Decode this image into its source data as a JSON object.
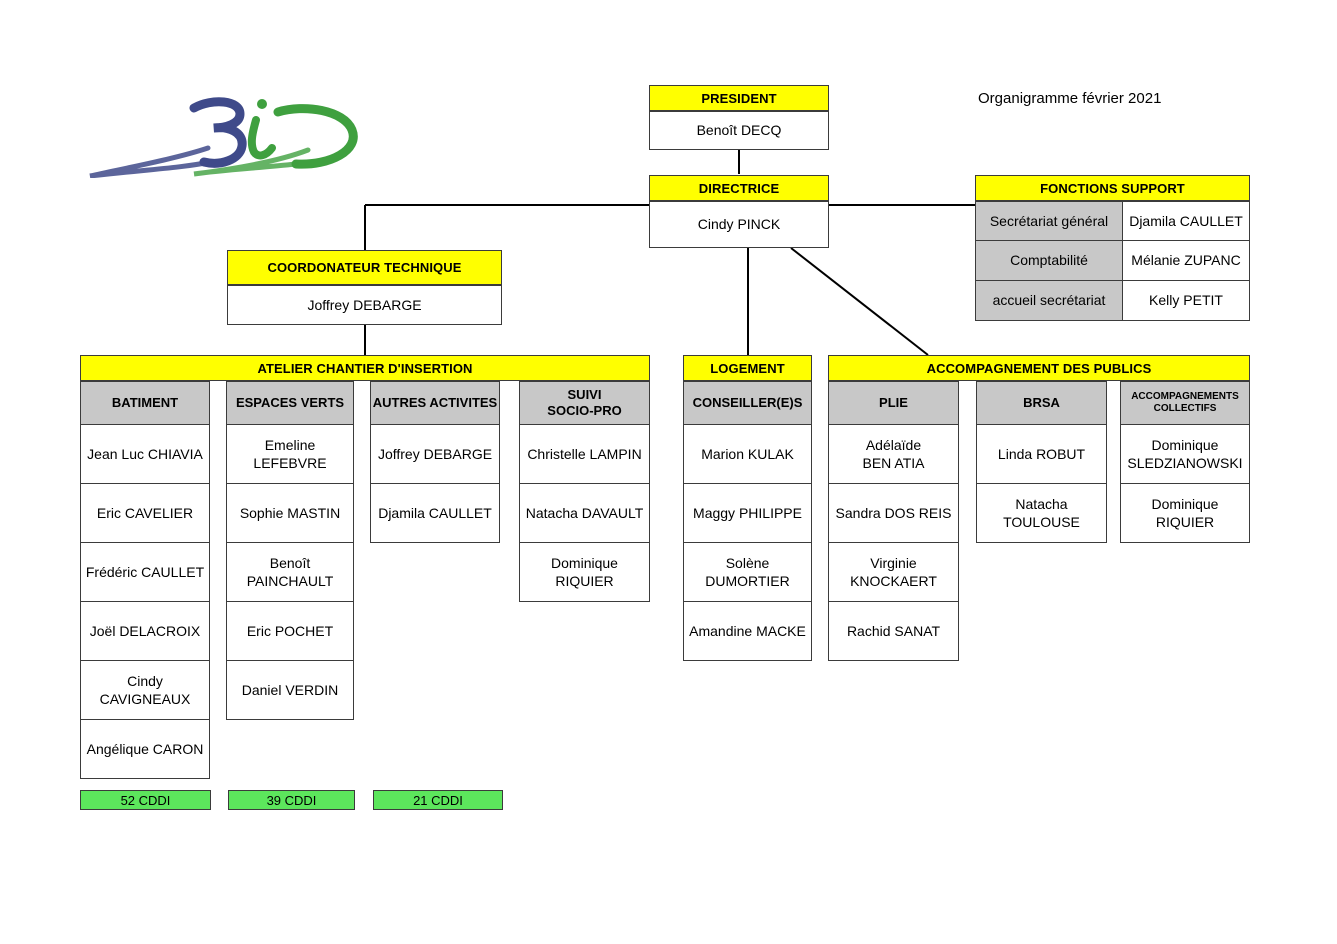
{
  "document": {
    "title": "Organigramme  février 2021",
    "logo_alt": "3iD"
  },
  "colors": {
    "header_yellow": "#FFFF00",
    "subheader_grey": "#C8C8C8",
    "count_green": "#5CE65C",
    "border": "#3b3b3b",
    "logo_blue": "#3f4a8a",
    "logo_green": "#3fa03f"
  },
  "president": {
    "title": "PRESIDENT",
    "name": "Benoît DECQ"
  },
  "directrice": {
    "title": "DIRECTRICE",
    "name": "Cindy PINCK"
  },
  "coordonateur": {
    "title": "COORDONATEUR TECHNIQUE",
    "name": "Joffrey DEBARGE"
  },
  "fonctions_support": {
    "title": "FONCTIONS SUPPORT",
    "rows": [
      {
        "role": "Secrétariat général",
        "name": "Djamila CAULLET"
      },
      {
        "role": "Comptabilité",
        "name": "Mélanie ZUPANC"
      },
      {
        "role": "accueil secrétariat",
        "name": "Kelly PETIT"
      }
    ]
  },
  "atelier": {
    "title": "ATELIER CHANTIER D'INSERTION",
    "columns": [
      {
        "header": "BATIMENT",
        "members": [
          "Jean Luc CHIAVIA",
          "Eric CAVELIER",
          "Frédéric CAULLET",
          "Joël DELACROIX",
          "Cindy\nCAVIGNEAUX",
          "Angélique CARON"
        ]
      },
      {
        "header": "ESPACES VERTS",
        "members": [
          "Emeline LEFEBVRE",
          "Sophie MASTIN",
          "Benoît\nPAINCHAULT",
          "Eric POCHET",
          "Daniel VERDIN"
        ]
      },
      {
        "header": "AUTRES ACTIVITES",
        "members": [
          "Joffrey DEBARGE",
          "Djamila CAULLET"
        ]
      },
      {
        "header": "SUIVI\nSOCIO-PRO",
        "members": [
          "Christelle LAMPIN",
          "Natacha DAVAULT",
          "Dominique\nRIQUIER"
        ]
      }
    ]
  },
  "logement": {
    "title": "LOGEMENT",
    "columns": [
      {
        "header": "CONSEILLER(E)S",
        "members": [
          "Marion KULAK",
          "Maggy PHILIPPE",
          "Solène\nDUMORTIER",
          "Amandine MACKE"
        ]
      }
    ]
  },
  "accompagnement": {
    "title": "ACCOMPAGNEMENT DES PUBLICS",
    "columns": [
      {
        "header": "PLIE",
        "members": [
          "Adélaïde\nBEN ATIA",
          "Sandra DOS REIS",
          "Virginie\nKNOCKAERT",
          "Rachid SANAT"
        ]
      },
      {
        "header": "BRSA",
        "members": [
          "Linda ROBUT",
          "Natacha\nTOULOUSE"
        ]
      },
      {
        "header": "ACCOMPAGNEMENTS\nCOLLECTIFS",
        "members": [
          "Dominique\nSLEDZIANOWSKI",
          "Dominique\nRIQUIER"
        ]
      }
    ]
  },
  "counts": [
    {
      "label": "52 CDDI"
    },
    {
      "label": "39 CDDI"
    },
    {
      "label": "21 CDDI"
    }
  ]
}
